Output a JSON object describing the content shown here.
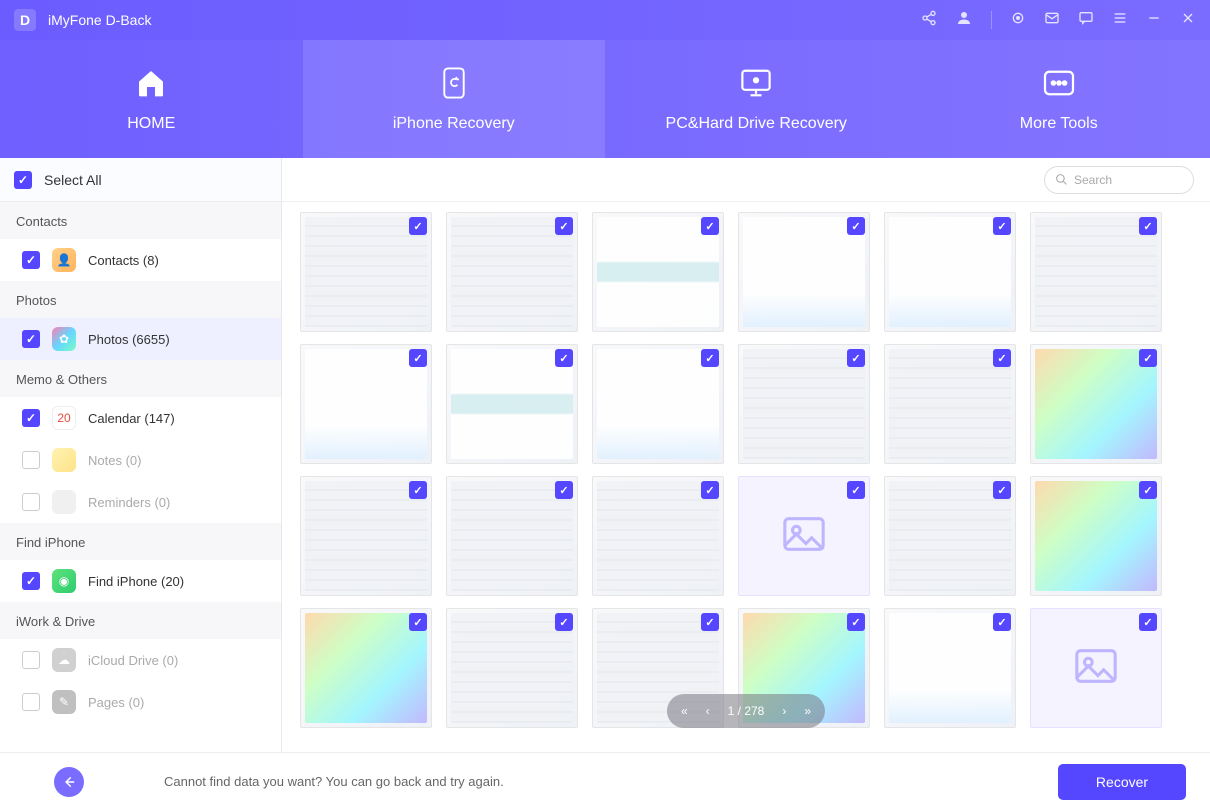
{
  "titlebar": {
    "logo": "D",
    "title": "iMyFone D-Back"
  },
  "topnav": {
    "home": "HOME",
    "iphone": "iPhone Recovery",
    "pc": "PC&Hard Drive Recovery",
    "more": "More Tools"
  },
  "sidebar": {
    "select_all": "Select All",
    "sections": {
      "contacts_h": "Contacts",
      "contacts": "Contacts (8)",
      "photos_h": "Photos",
      "photos": "Photos (6655)",
      "memo_h": "Memo & Others",
      "calendar": "Calendar (147)",
      "notes": "Notes (0)",
      "reminders": "Reminders (0)",
      "find_h": "Find iPhone",
      "find": "Find iPhone (20)",
      "iwork_h": "iWork & Drive",
      "icloud": "iCloud Drive (0)",
      "pages": "Pages (0)"
    },
    "calendar_day": "20"
  },
  "search": {
    "placeholder": "Search"
  },
  "pager": {
    "text": "1 / 278"
  },
  "footer": {
    "hint": "Cannot find data you want? You can go back and try again.",
    "recover": "Recover"
  }
}
